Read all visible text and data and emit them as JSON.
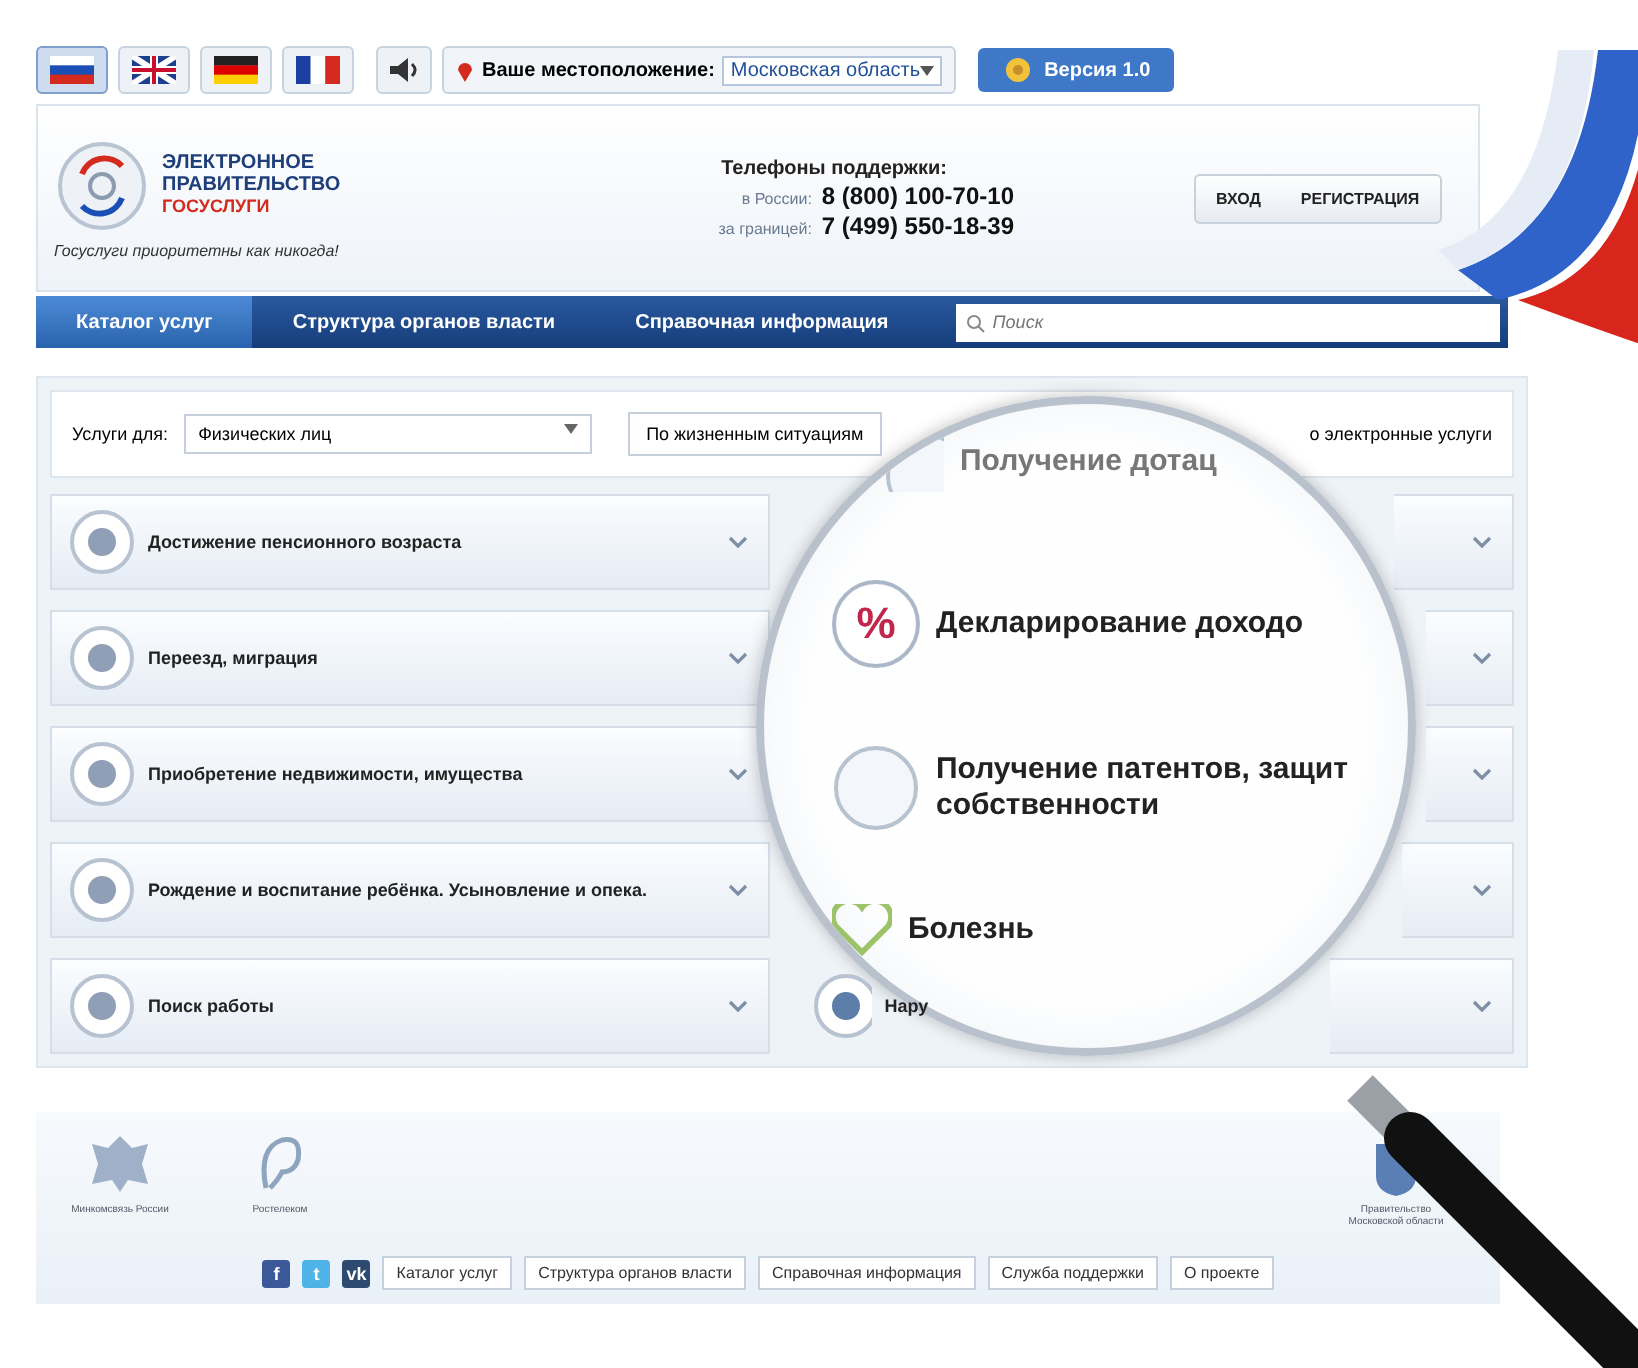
{
  "languages": [
    {
      "kind": "ru",
      "selected": true
    },
    {
      "kind": "uk",
      "selected": false
    },
    {
      "kind": "de",
      "selected": false
    },
    {
      "kind": "fr",
      "selected": false
    }
  ],
  "location": {
    "label": "Ваше местоположение:",
    "value": "Московская область"
  },
  "version_button": "Версия 1.0",
  "logo": {
    "line_1": "ЭЛЕКТРОННОЕ",
    "line_2": "ПРАВИТЕЛЬСТВО",
    "line_3": "ГОСУСЛУГИ",
    "tagline": "Госуслуги приоритетны как никогда!"
  },
  "support": {
    "title": "Телефоны поддержки:",
    "phones": [
      {
        "label": "в России:",
        "number": "8 (800) 100-70-10"
      },
      {
        "label": "за границей:",
        "number": "7 (499) 550-18-39"
      }
    ]
  },
  "auth_buttons": [
    "ВХОД",
    "РЕГИСТРАЦИЯ"
  ],
  "nav_tabs": [
    {
      "label": "Каталог услуг",
      "selected": true
    },
    {
      "label": "Структура органов власти",
      "selected": false
    },
    {
      "label": "Справочная информация",
      "selected": false
    }
  ],
  "search": {
    "placeholder": "Поиск"
  },
  "filter": {
    "label": "Услуги для:",
    "select_value": "Физических лиц",
    "situations": "По жизненным ситуациям",
    "electronic": "о электронные услуги"
  },
  "left_categories": [
    {
      "label": "Достижение пенсионного возраста"
    },
    {
      "label": "Переезд, миграция"
    },
    {
      "label": "Приобретение недвижимости, имущества"
    },
    {
      "label": "Рождение и воспитание ребёнка. Усыновление и опека."
    },
    {
      "label": "Поиск работы"
    }
  ],
  "right_categories": [
    {
      "kind": "hidden"
    },
    {
      "kind": "hidden"
    },
    {
      "kind": "hidden"
    },
    {
      "kind": "hidden"
    },
    {
      "kind": "labeled",
      "label": "Нару"
    }
  ],
  "lens": {
    "items": [
      {
        "label": "Получение дотац",
        "kind": "plain"
      },
      {
        "label": "Декларирование доходо",
        "kind": "percent",
        "icon_text": "%"
      },
      {
        "label": "Получение патентов, защит собственности",
        "kind": "plain"
      },
      {
        "label": "Болезнь",
        "kind": "health"
      }
    ]
  },
  "footer": {
    "partners": [
      {
        "kind": "emblem",
        "caption": "Минкомсвязь России"
      },
      {
        "kind": "ear",
        "caption": "Ростелеком"
      },
      {
        "kind": "region",
        "caption": "Правительство Московской области"
      }
    ],
    "social": [
      "f",
      "t",
      "vk"
    ],
    "links": [
      "Каталог услуг",
      "Структура органов власти",
      "Справочная информация",
      "Служба поддержки",
      "О проекте"
    ]
  }
}
